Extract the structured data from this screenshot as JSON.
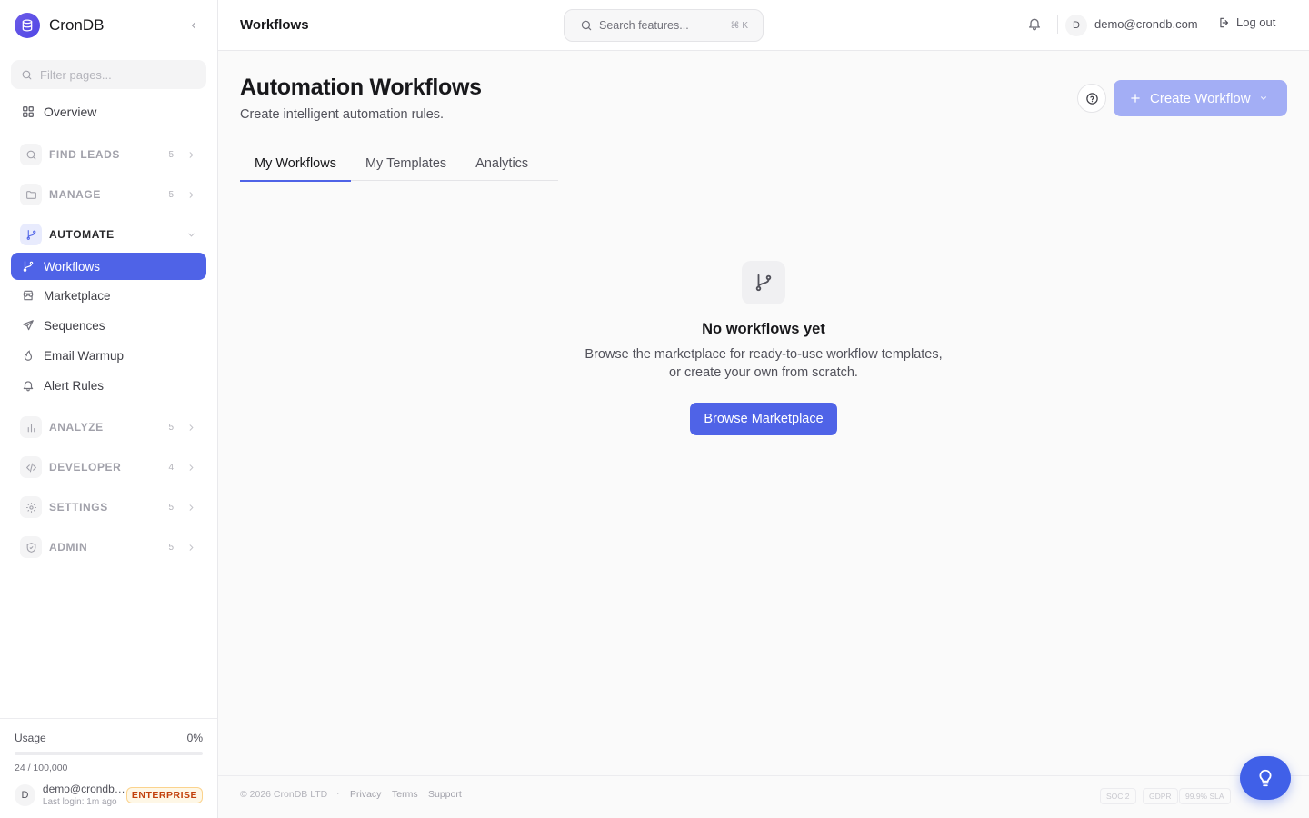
{
  "app": {
    "name": "CronDB"
  },
  "sidebar": {
    "filter_placeholder": "Filter pages...",
    "overview_label": "Overview",
    "groups": [
      {
        "label": "FIND LEADS",
        "count": "5"
      },
      {
        "label": "MANAGE",
        "count": "5"
      },
      {
        "label": "AUTOMATE",
        "count": ""
      },
      {
        "label": "ANALYZE",
        "count": "5"
      },
      {
        "label": "DEVELOPER",
        "count": "4"
      },
      {
        "label": "SETTINGS",
        "count": "5"
      },
      {
        "label": "ADMIN",
        "count": "5"
      }
    ],
    "automate_items": [
      {
        "label": "Workflows",
        "icon": "git-branch-icon"
      },
      {
        "label": "Marketplace",
        "icon": "store-icon"
      },
      {
        "label": "Sequences",
        "icon": "send-icon"
      },
      {
        "label": "Email Warmup",
        "icon": "flame-icon"
      },
      {
        "label": "Alert Rules",
        "icon": "bell-icon"
      }
    ],
    "usage": {
      "label": "Usage",
      "percent_label": "0%",
      "fraction": 0.00024,
      "count": "24 / 100,000"
    },
    "user": {
      "avatar": "D",
      "email": "demo@crondb.com",
      "last_login": "Last login: 1m ago",
      "plan": "ENTERPRISE"
    }
  },
  "header": {
    "breadcrumb": "Workflows",
    "search_placeholder": "Search features...",
    "search_shortcut": "⌘ K",
    "avatar": "D",
    "email": "demo@crondb.com",
    "logout": "Log out"
  },
  "main": {
    "title": "Automation Workflows",
    "subtitle": "Create intelligent automation rules.",
    "create_button": "Create Workflow",
    "tabs": [
      "My Workflows",
      "My Templates",
      "Analytics"
    ],
    "active_tab": "My Workflows",
    "empty": {
      "title": "No workflows yet",
      "description": "Browse the marketplace for ready-to-use workflow templates, or create your own from scratch.",
      "button": "Browse Marketplace"
    }
  },
  "footer": {
    "copyright": "© 2026 CronDB LTD",
    "separator": "·",
    "links": [
      "Privacy",
      "Terms",
      "Support"
    ],
    "badges": [
      "SOC 2",
      "GDPR",
      "99.9% SLA"
    ]
  },
  "colors": {
    "accent": "#4f63e7",
    "accent_muted": "#a3aef5",
    "plan_badge": "#c2410c"
  }
}
